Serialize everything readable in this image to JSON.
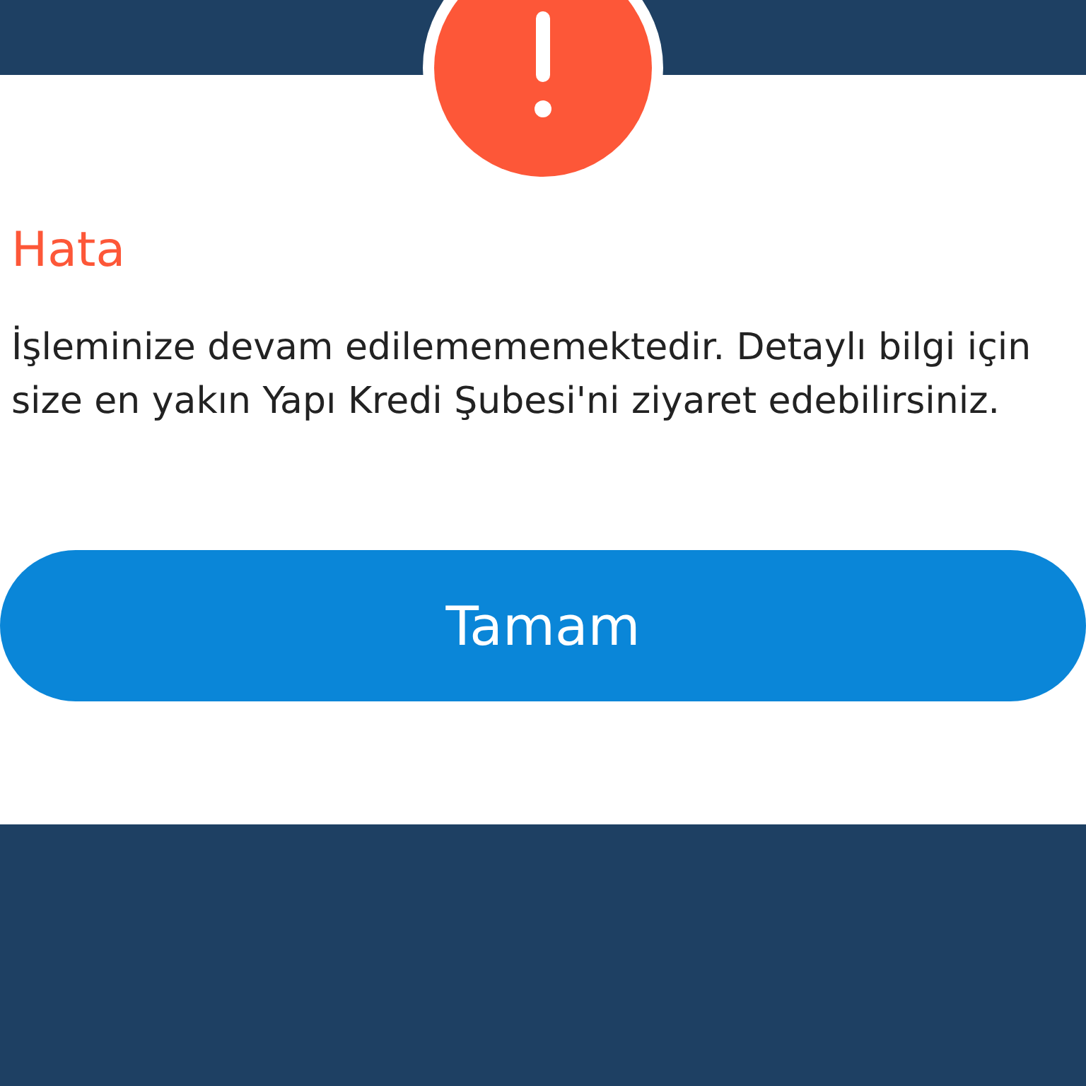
{
  "dialog": {
    "kind": "error",
    "title": "Hata",
    "message": "İşleminize devam edilemememektedir. Detaylı bilgi için size en yakın Yapı Kredi Şubesi'ni ziyaret edebilirsiniz.",
    "button": "Tamam"
  }
}
